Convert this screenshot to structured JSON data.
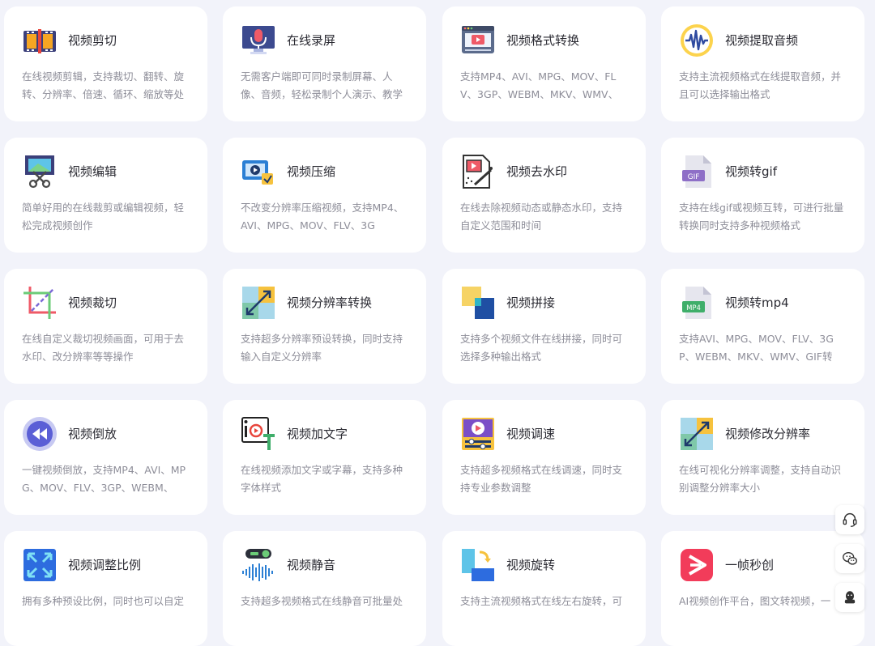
{
  "tools": [
    {
      "icon": "video-cut-icon",
      "title": "视频剪切",
      "desc": "在线视频剪辑，支持裁切、翻转、旋转、分辨率、倍速、循环、缩放等处"
    },
    {
      "icon": "screen-record-icon",
      "title": "在线录屏",
      "desc": "无需客户端即可同时录制屏幕、人像、音频，轻松录制个人演示、教学"
    },
    {
      "icon": "format-convert-icon",
      "title": "视频格式转换",
      "desc": "支持MP4、AVI、MPG、MOV、FLV、3GP、WEBM、MKV、WMV、"
    },
    {
      "icon": "audio-extract-icon",
      "title": "视频提取音频",
      "desc": "支持主流视频格式在线提取音频，并且可以选择输出格式"
    },
    {
      "icon": "video-edit-icon",
      "title": "视频编辑",
      "desc": "简单好用的在线裁剪或编辑视频，轻松完成视频创作"
    },
    {
      "icon": "video-compress-icon",
      "title": "视频压缩",
      "desc": "不改变分辨率压缩视频，支持MP4、AVI、MPG、MOV、FLV、3G"
    },
    {
      "icon": "watermark-remove-icon",
      "title": "视频去水印",
      "desc": "在线去除视频动态或静态水印，支持自定义范围和时间"
    },
    {
      "icon": "gif-file-icon",
      "title": "视频转gif",
      "desc": "支持在线gif或视频互转，可进行批量转换同时支持多种视频格式"
    },
    {
      "icon": "crop-icon",
      "title": "视频裁切",
      "desc": "在线自定义裁切视频画面，可用于去水印、改分辨率等等操作"
    },
    {
      "icon": "resolution-convert-icon",
      "title": "视频分辨率转换",
      "desc": "支持超多分辨率预设转换，同时支持输入自定义分辨率"
    },
    {
      "icon": "merge-icon",
      "title": "视频拼接",
      "desc": "支持多个视频文件在线拼接，同时可选择多种输出格式"
    },
    {
      "icon": "mp4-file-icon",
      "title": "视频转mp4",
      "desc": "支持AVI、MPG、MOV、FLV、3GP、WEBM、MKV、WMV、GIF转"
    },
    {
      "icon": "rewind-icon",
      "title": "视频倒放",
      "desc": "一键视频倒放，支持MP4、AVI、MPG、MOV、FLV、3GP、WEBM、"
    },
    {
      "icon": "add-text-icon",
      "title": "视频加文字",
      "desc": "在线视频添加文字或字幕，支持多种字体样式"
    },
    {
      "icon": "speed-adjust-icon",
      "title": "视频调速",
      "desc": "支持超多视频格式在线调速，同时支持专业参数调整"
    },
    {
      "icon": "resolution-edit-icon",
      "title": "视频修改分辨率",
      "desc": "在线可视化分辨率调整，支持自动识别调整分辨率大小"
    },
    {
      "icon": "aspect-ratio-icon",
      "title": "视频调整比例",
      "desc": "拥有多种预设比例，同时也可以自定"
    },
    {
      "icon": "mute-icon",
      "title": "视频静音",
      "desc": "支持超多视频格式在线静音可批量处"
    },
    {
      "icon": "rotate-icon",
      "title": "视频旋转",
      "desc": "支持主流视频格式在线左右旋转，可"
    },
    {
      "icon": "yizhen-logo-icon",
      "title": "一帧秒创",
      "desc": "AI视频创作平台，图文转视频，一"
    }
  ],
  "float_buttons": [
    {
      "icon": "headset-icon"
    },
    {
      "icon": "wechat-icon"
    },
    {
      "icon": "qq-icon"
    }
  ],
  "colors": {
    "page_background": "#f2f3fa",
    "card_background": "#ffffff",
    "title_text": "#2b2b33",
    "desc_text": "#8e8e99"
  }
}
